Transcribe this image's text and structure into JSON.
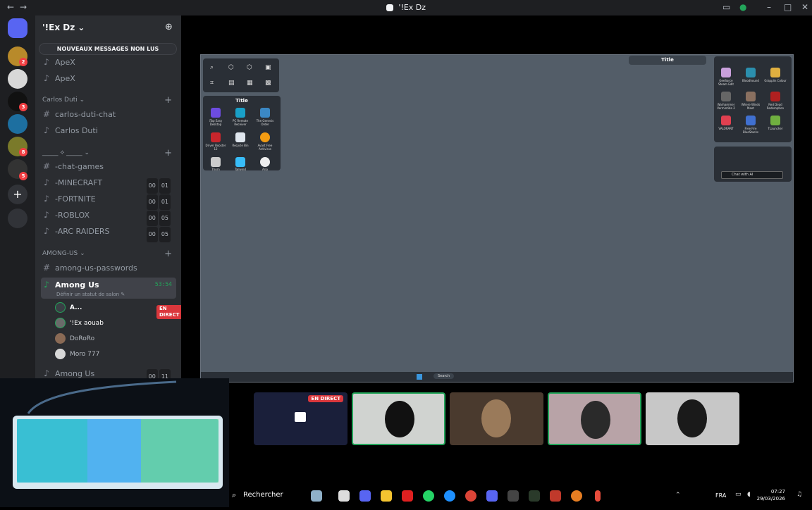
{
  "window": {
    "title": "'!Ex Dz"
  },
  "server": {
    "name": "'!Ex Dz",
    "unread_banner": "NOUVEAUX MESSAGES NON LUS"
  },
  "rail_badges": [
    "2",
    "3",
    "8",
    "5"
  ],
  "channels": {
    "top": [
      {
        "type": "voice",
        "name": "ApeX"
      },
      {
        "type": "voice",
        "name": "ApeX"
      }
    ],
    "cat1": "Carlos Duti",
    "cat1_items": [
      {
        "type": "text",
        "name": "carlos-duti-chat"
      },
      {
        "type": "voice",
        "name": "Carlos Duti"
      }
    ],
    "cat2": "_____ ⟡ _____",
    "cat2_items": [
      {
        "type": "text",
        "name": "-chat-games"
      },
      {
        "type": "voice",
        "name": "-MINECRAFT",
        "c1": "00",
        "c2": "01"
      },
      {
        "type": "voice",
        "name": "-FORTNITE",
        "c1": "00",
        "c2": "01"
      },
      {
        "type": "voice",
        "name": "-ROBLOX",
        "c1": "00",
        "c2": "05"
      },
      {
        "type": "voice",
        "name": "-ARC RAIDERS",
        "c1": "00",
        "c2": "05"
      }
    ],
    "cat3": "AMONG-US",
    "cat3_items": [
      {
        "type": "text",
        "name": "among-us-passwords"
      }
    ],
    "active": {
      "name": "Among Us",
      "status": "Définir un statut de salon",
      "timer": "53:54"
    },
    "users": [
      {
        "name": "A...",
        "live": "EN DIRECT"
      },
      {
        "name": "'!Ex aouab"
      },
      {
        "name": "DoRoRo"
      },
      {
        "name": "Moro 777"
      }
    ],
    "bottom": {
      "name": "Among Us",
      "c1": "00",
      "c2": "11"
    }
  },
  "stream": {
    "panel_title": "Title",
    "desktop_icons": [
      "iTop Easy Desktop",
      "PC Remote Receiver",
      "The Genesis Order",
      "Driver Booster 12",
      "Recycle Bin",
      "Avast Free Antivirus",
      "Thorn",
      "Tailwind",
      "Ario"
    ],
    "right_panel_title": "Title",
    "right_icons": [
      "GeeSorce Steam Edit",
      "Bloodhound",
      "Grapplin Colour",
      "Warhammer Vermintide 2",
      "Where Winds Meet",
      "Red Dead Redemption",
      "VALORANT",
      "Free Fire BlueStacks",
      "TLauncher"
    ],
    "chat_ai": "Chat with AI",
    "mini_search": "Search"
  },
  "tiles": {
    "live_badge": "EN DIRECT"
  },
  "taskbar": {
    "search": "Rechercher",
    "lang": "FRA",
    "time": "07:27",
    "date": "29/03/2026"
  },
  "colors": {
    "live": "#da373c",
    "accent": "#23a55a",
    "bg": "#2b2d31"
  }
}
